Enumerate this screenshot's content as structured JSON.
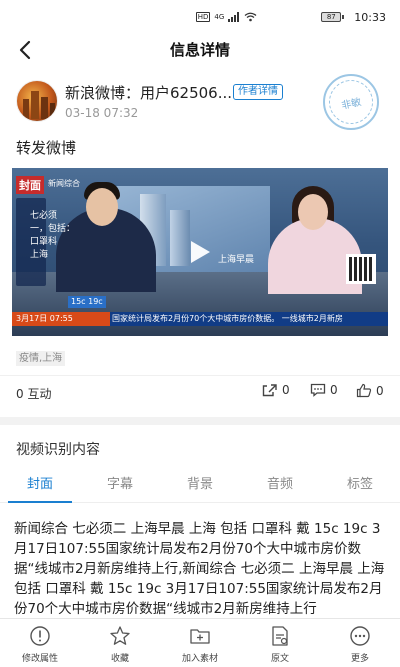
{
  "status_bar": {
    "network_label": "HD",
    "signal_label": "4G",
    "battery_level": "87",
    "time": "10:33"
  },
  "nav": {
    "title": "信息详情"
  },
  "author": {
    "name": "新浪微博：用户62506...",
    "tag": "作者详情",
    "time": "03-18 07:32",
    "stamp_text": "非敏"
  },
  "post": {
    "text": "转发微博"
  },
  "video": {
    "brand": "封面",
    "channel_logo": "新闻综合",
    "side_lines": [
      "七必须",
      "一，包括：",
      "口罩科"
    ],
    "side_city": "上海",
    "screen_label": "上海早晨",
    "date": "3月17日 07:55",
    "weather": "15c 19c",
    "ticker": "国家统计局发布2月份70个大中城市房价数据。  一线城市2月新房"
  },
  "tags": [
    "疫情,上海"
  ],
  "stats": {
    "interact_label": "0 互动",
    "share_count": "0",
    "comment_count": "0",
    "like_count": "0"
  },
  "recognition": {
    "section_title": "视频识别内容",
    "tabs": [
      "封面",
      "字幕",
      "背景",
      "音频",
      "标签"
    ],
    "active_tab": "封面",
    "text": "新闻综合 七必须二 上海早晨 上海 包括 口罩科 戴 15c 19c 3月17日107:55国家统计局发布2月份70个大中城市房价数据“线城市2月新房维持上行,新闻综合 七必须二 上海早晨 上海 包括 口罩科 戴 15c 19c 3月17日107:55国家统计局发布2月份70个大中城市房价数据“线城市2月新房维持上行"
  },
  "bottom_bar": {
    "items": [
      "修改属性",
      "收藏",
      "加入素材",
      "原文",
      "更多"
    ]
  },
  "colors": {
    "accent": "#1a7fd0",
    "stamp": "#9cc6e4"
  }
}
